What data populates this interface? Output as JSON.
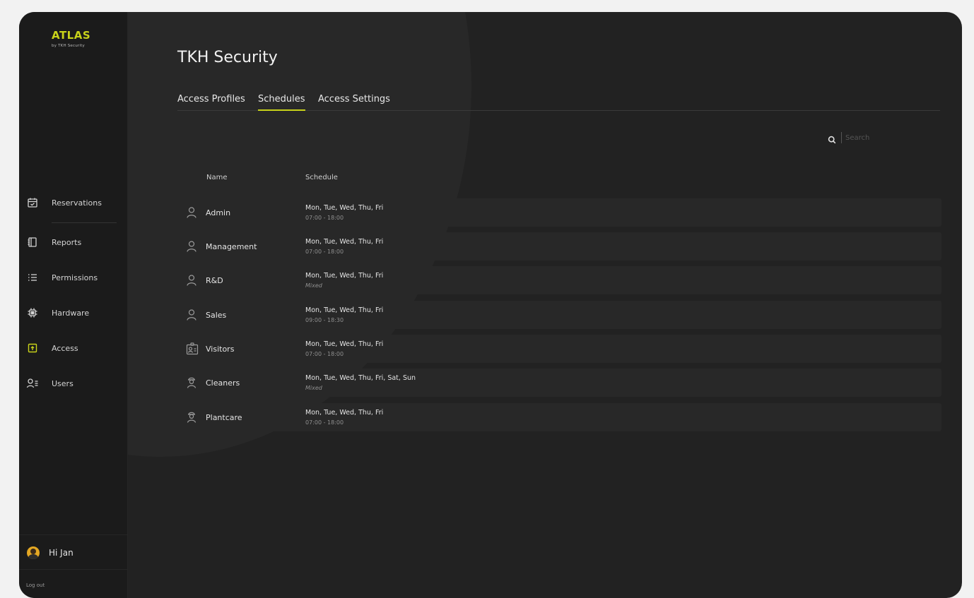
{
  "brand": {
    "name": "ATLAS",
    "subtitle": "by TKH Security",
    "accent": "#c8d21a"
  },
  "sidebar": {
    "items": [
      {
        "label": "Reservations",
        "icon": "calendar-check-icon"
      },
      {
        "label": "Reports",
        "icon": "book-icon"
      },
      {
        "label": "Permissions",
        "icon": "list-icon"
      },
      {
        "label": "Hardware",
        "icon": "chip-icon"
      },
      {
        "label": "Access",
        "icon": "access-door-icon",
        "active": true
      },
      {
        "label": "Users",
        "icon": "users-icon"
      }
    ],
    "greeting": "Hi Jan",
    "logout": "Log out"
  },
  "main": {
    "title": "TKH Security",
    "tabs": [
      {
        "label": "Access Profiles",
        "active": false
      },
      {
        "label": "Schedules",
        "active": true
      },
      {
        "label": "Access Settings",
        "active": false
      }
    ],
    "search": {
      "placeholder": "Search"
    },
    "columns": {
      "name": "Name",
      "schedule": "Schedule"
    },
    "rows": [
      {
        "name": "Admin",
        "days": "Mon, Tue, Wed, Thu, Fri",
        "time": "07:00 - 18:00",
        "icon": "user-icon"
      },
      {
        "name": "Management",
        "days": "Mon, Tue, Wed, Thu, Fri",
        "time": "07:00 - 18:00",
        "icon": "user-icon"
      },
      {
        "name": "R&D",
        "days": "Mon, Tue, Wed, Thu, Fri",
        "time": "Mixed",
        "icon": "user-icon"
      },
      {
        "name": "Sales",
        "days": "Mon, Tue, Wed, Thu, Fri",
        "time": "09:00 - 18:30",
        "icon": "user-icon"
      },
      {
        "name": "Visitors",
        "days": "Mon, Tue, Wed, Thu, Fri",
        "time": "07:00 - 18:00",
        "icon": "visitor-badge-icon"
      },
      {
        "name": "Cleaners",
        "days": "Mon, Tue, Wed, Thu, Fri, Sat, Sun",
        "time": "Mixed",
        "icon": "worker-icon"
      },
      {
        "name": "Plantcare",
        "days": "Mon, Tue, Wed, Thu, Fri",
        "time": "07:00 - 18:00",
        "icon": "worker-icon"
      }
    ]
  }
}
